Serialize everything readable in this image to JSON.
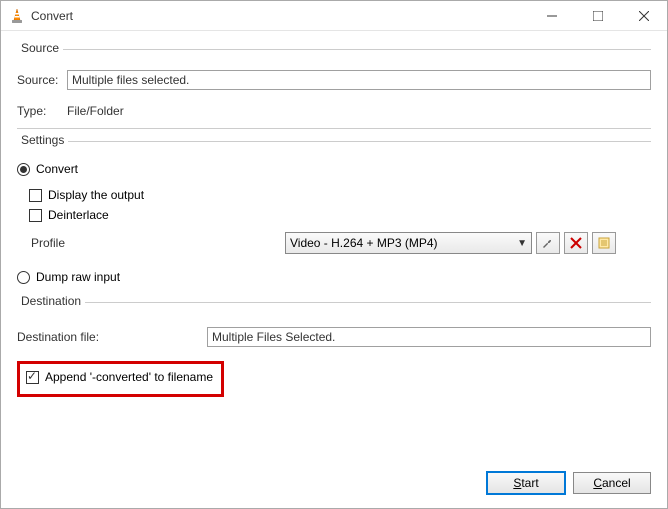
{
  "window": {
    "title": "Convert"
  },
  "sections": {
    "source": {
      "legend": "Source",
      "source_label": "Source:",
      "source_value": "Multiple files selected.",
      "type_label": "Type:",
      "type_value": "File/Folder"
    },
    "settings": {
      "legend": "Settings",
      "convert_radio": "Convert",
      "display_output": "Display the output",
      "deinterlace": "Deinterlace",
      "profile_label": "Profile",
      "profile_value": "Video - H.264 + MP3 (MP4)",
      "dump_raw": "Dump raw input"
    },
    "destination": {
      "legend": "Destination",
      "dest_label": "Destination file:",
      "dest_value": "Multiple Files Selected.",
      "append_label": "Append '-converted' to filename"
    }
  },
  "buttons": {
    "start": "Start",
    "cancel": "Cancel"
  },
  "icons": {
    "tools": "wrench-icon",
    "delete": "x-icon",
    "new": "new-profile-icon"
  }
}
